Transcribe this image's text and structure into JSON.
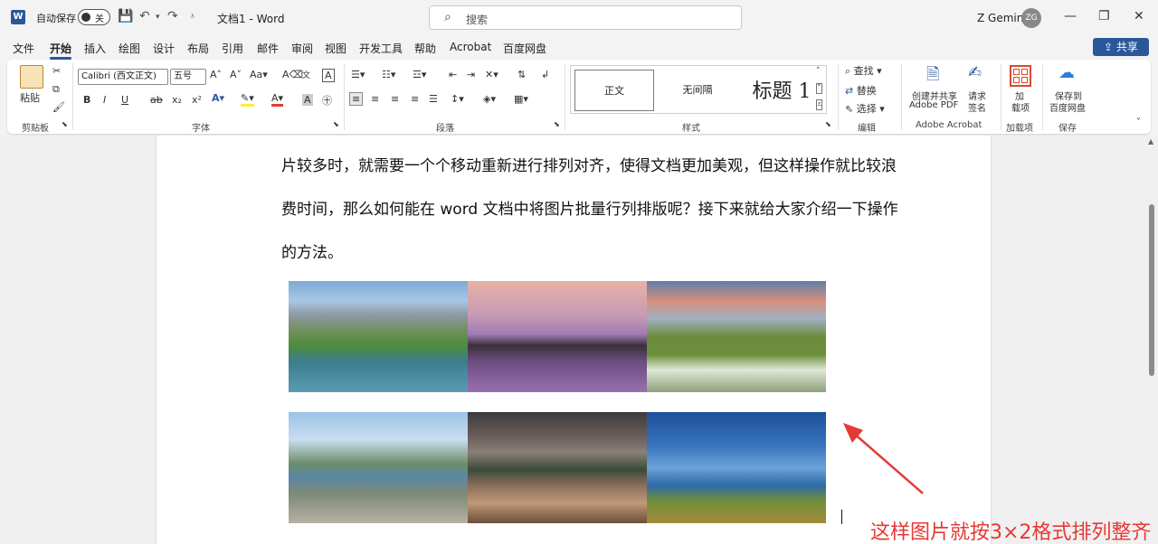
{
  "titlebar": {
    "app_logo": "W",
    "autosave_label": "自动保存",
    "toggle_state": "关",
    "doc_title": "文档1  -  Word",
    "search_placeholder": "搜索",
    "user_name": "Z Gemini",
    "user_initials": "ZG",
    "icons": [
      "save-icon",
      "undo-icon",
      "redo-icon",
      "customize-icon",
      "minimize-icon",
      "maximize-icon",
      "close-icon"
    ]
  },
  "tabs": [
    "文件",
    "开始",
    "插入",
    "绘图",
    "设计",
    "布局",
    "引用",
    "邮件",
    "审阅",
    "视图",
    "开发工具",
    "帮助",
    "Acrobat",
    "百度网盘"
  ],
  "active_tab": "开始",
  "share_label": "共享",
  "ribbon": {
    "clipboard": {
      "paste_label": "粘贴",
      "group": "剪贴板"
    },
    "font": {
      "font_name": "Calibri (西文正文)",
      "font_size": "五号",
      "group": "字体",
      "bold": "B",
      "italic": "I",
      "underline": "U",
      "strike": "ab",
      "sub": "x₂",
      "sup": "x²"
    },
    "paragraph": {
      "group": "段落"
    },
    "styles": {
      "group": "样式",
      "items": [
        "正文",
        "无间隔",
        "标题 1"
      ]
    },
    "editing": {
      "group": "编辑",
      "find": "查找",
      "replace": "替换",
      "select": "选择"
    },
    "acrobat": {
      "group": "Adobe Acrobat",
      "create_share": "创建并共享",
      "adobe_pdf": "Adobe PDF",
      "request_sign": "请求",
      "sign_label": "签名"
    },
    "addins": {
      "group": "加载项",
      "label1": "加",
      "label2": "载项"
    },
    "save": {
      "group": "保存",
      "label1": "保存到",
      "label2": "百度网盘"
    }
  },
  "document": {
    "lines": [
      "片较多时，就需要一个个移动重新进行排列对齐，使得文档更加美观，但这样操作就比较浪",
      "费时间，那么如何能在 word 文档中将图片批量行列排版呢？接下来就给大家介绍一下操作",
      "的方法。"
    ]
  },
  "annotation": {
    "caption": "这样图片就按3×2格式排列整齐",
    "color": "#e53935"
  },
  "colors": {
    "accent": "#2b579a"
  }
}
